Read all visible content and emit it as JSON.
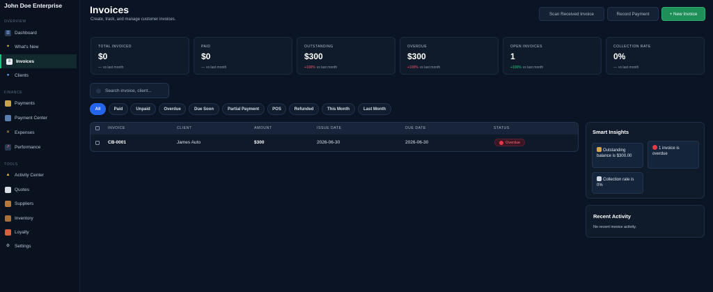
{
  "brand": "John Doe Enterprise",
  "sidebar": {
    "sections": [
      {
        "label": "OVERVIEW"
      },
      {
        "label": "FINANCE"
      },
      {
        "label": "TOOLS"
      }
    ],
    "items": [
      {
        "label": "Dashboard",
        "icon": "chart-icon"
      },
      {
        "label": "What's New",
        "icon": "sparkle-icon"
      },
      {
        "label": "Invoices",
        "icon": "invoice-icon"
      },
      {
        "label": "Clients",
        "icon": "clients-icon"
      },
      {
        "label": "Payments",
        "icon": "card-icon"
      },
      {
        "label": "Payment Center",
        "icon": "payment-center-icon"
      },
      {
        "label": "Expenses",
        "icon": "expenses-icon"
      },
      {
        "label": "Performance",
        "icon": "performance-icon"
      },
      {
        "label": "Activity Center",
        "icon": "bell-icon"
      },
      {
        "label": "Quotes",
        "icon": "quotes-icon"
      },
      {
        "label": "Suppliers",
        "icon": "suppliers-icon"
      },
      {
        "label": "Inventory",
        "icon": "box-icon"
      },
      {
        "label": "Loyalty",
        "icon": "gift-icon"
      },
      {
        "label": "Settings",
        "icon": "gear-icon"
      }
    ],
    "active_index": 2
  },
  "header": {
    "title": "Invoices",
    "subtitle": "Create, track, and manage customer invoices.",
    "scan_label": "Scan Received Invoice",
    "record_label": "Record Payment",
    "new_label": "+ New Invoice"
  },
  "stats": [
    {
      "label": "TOTAL INVOICED",
      "value": "$0",
      "delta": "—",
      "delta_tone": "neutral",
      "suffix": "vs last month"
    },
    {
      "label": "PAID",
      "value": "$0",
      "delta": "—",
      "delta_tone": "neutral",
      "suffix": "vs last month"
    },
    {
      "label": "OUTSTANDING",
      "value": "$300",
      "delta": "+100%",
      "delta_tone": "red",
      "suffix": "vs last month"
    },
    {
      "label": "OVERDUE",
      "value": "$300",
      "delta": "+100%",
      "delta_tone": "red",
      "suffix": "vs last month"
    },
    {
      "label": "OPEN INVOICES",
      "value": "1",
      "delta": "+100%",
      "delta_tone": "green",
      "suffix": "vs last month"
    },
    {
      "label": "COLLECTION RATE",
      "value": "0%",
      "delta": "—",
      "delta_tone": "neutral",
      "suffix": "vs last month"
    }
  ],
  "search": {
    "placeholder": "Search invoice, client..."
  },
  "filters": [
    "All",
    "Paid",
    "Unpaid",
    "Overdue",
    "Due Soon",
    "Partial Payment",
    "POS",
    "Refunded",
    "This Month",
    "Last Month"
  ],
  "active_filter": "All",
  "table": {
    "columns": [
      "INVOICE",
      "CLIENT",
      "AMOUNT",
      "ISSUE DATE",
      "DUE DATE",
      "STATUS"
    ],
    "rows": [
      {
        "invoice": "CB-0001",
        "client": "James Auto",
        "amount": "$300",
        "issue_date": "2026-06-30",
        "due_date": "2026-06-30",
        "status": "Overdue"
      }
    ]
  },
  "insights": {
    "title": "Smart Insights",
    "items": [
      {
        "text": "Outstanding balance is $300.00",
        "icon": "money-bag-icon"
      },
      {
        "text": "1 invoice is overdue",
        "icon": "red-circle-icon"
      },
      {
        "text": "Collection rate is 0%",
        "icon": "chart-icon"
      }
    ]
  },
  "activity": {
    "title": "Recent Activity",
    "empty_text": "No recent invoice activity."
  },
  "colors": {
    "accent_green": "#19c37d",
    "primary_blue": "#2463eb",
    "danger_red": "#ff5a6a",
    "background": "#0b1424"
  }
}
